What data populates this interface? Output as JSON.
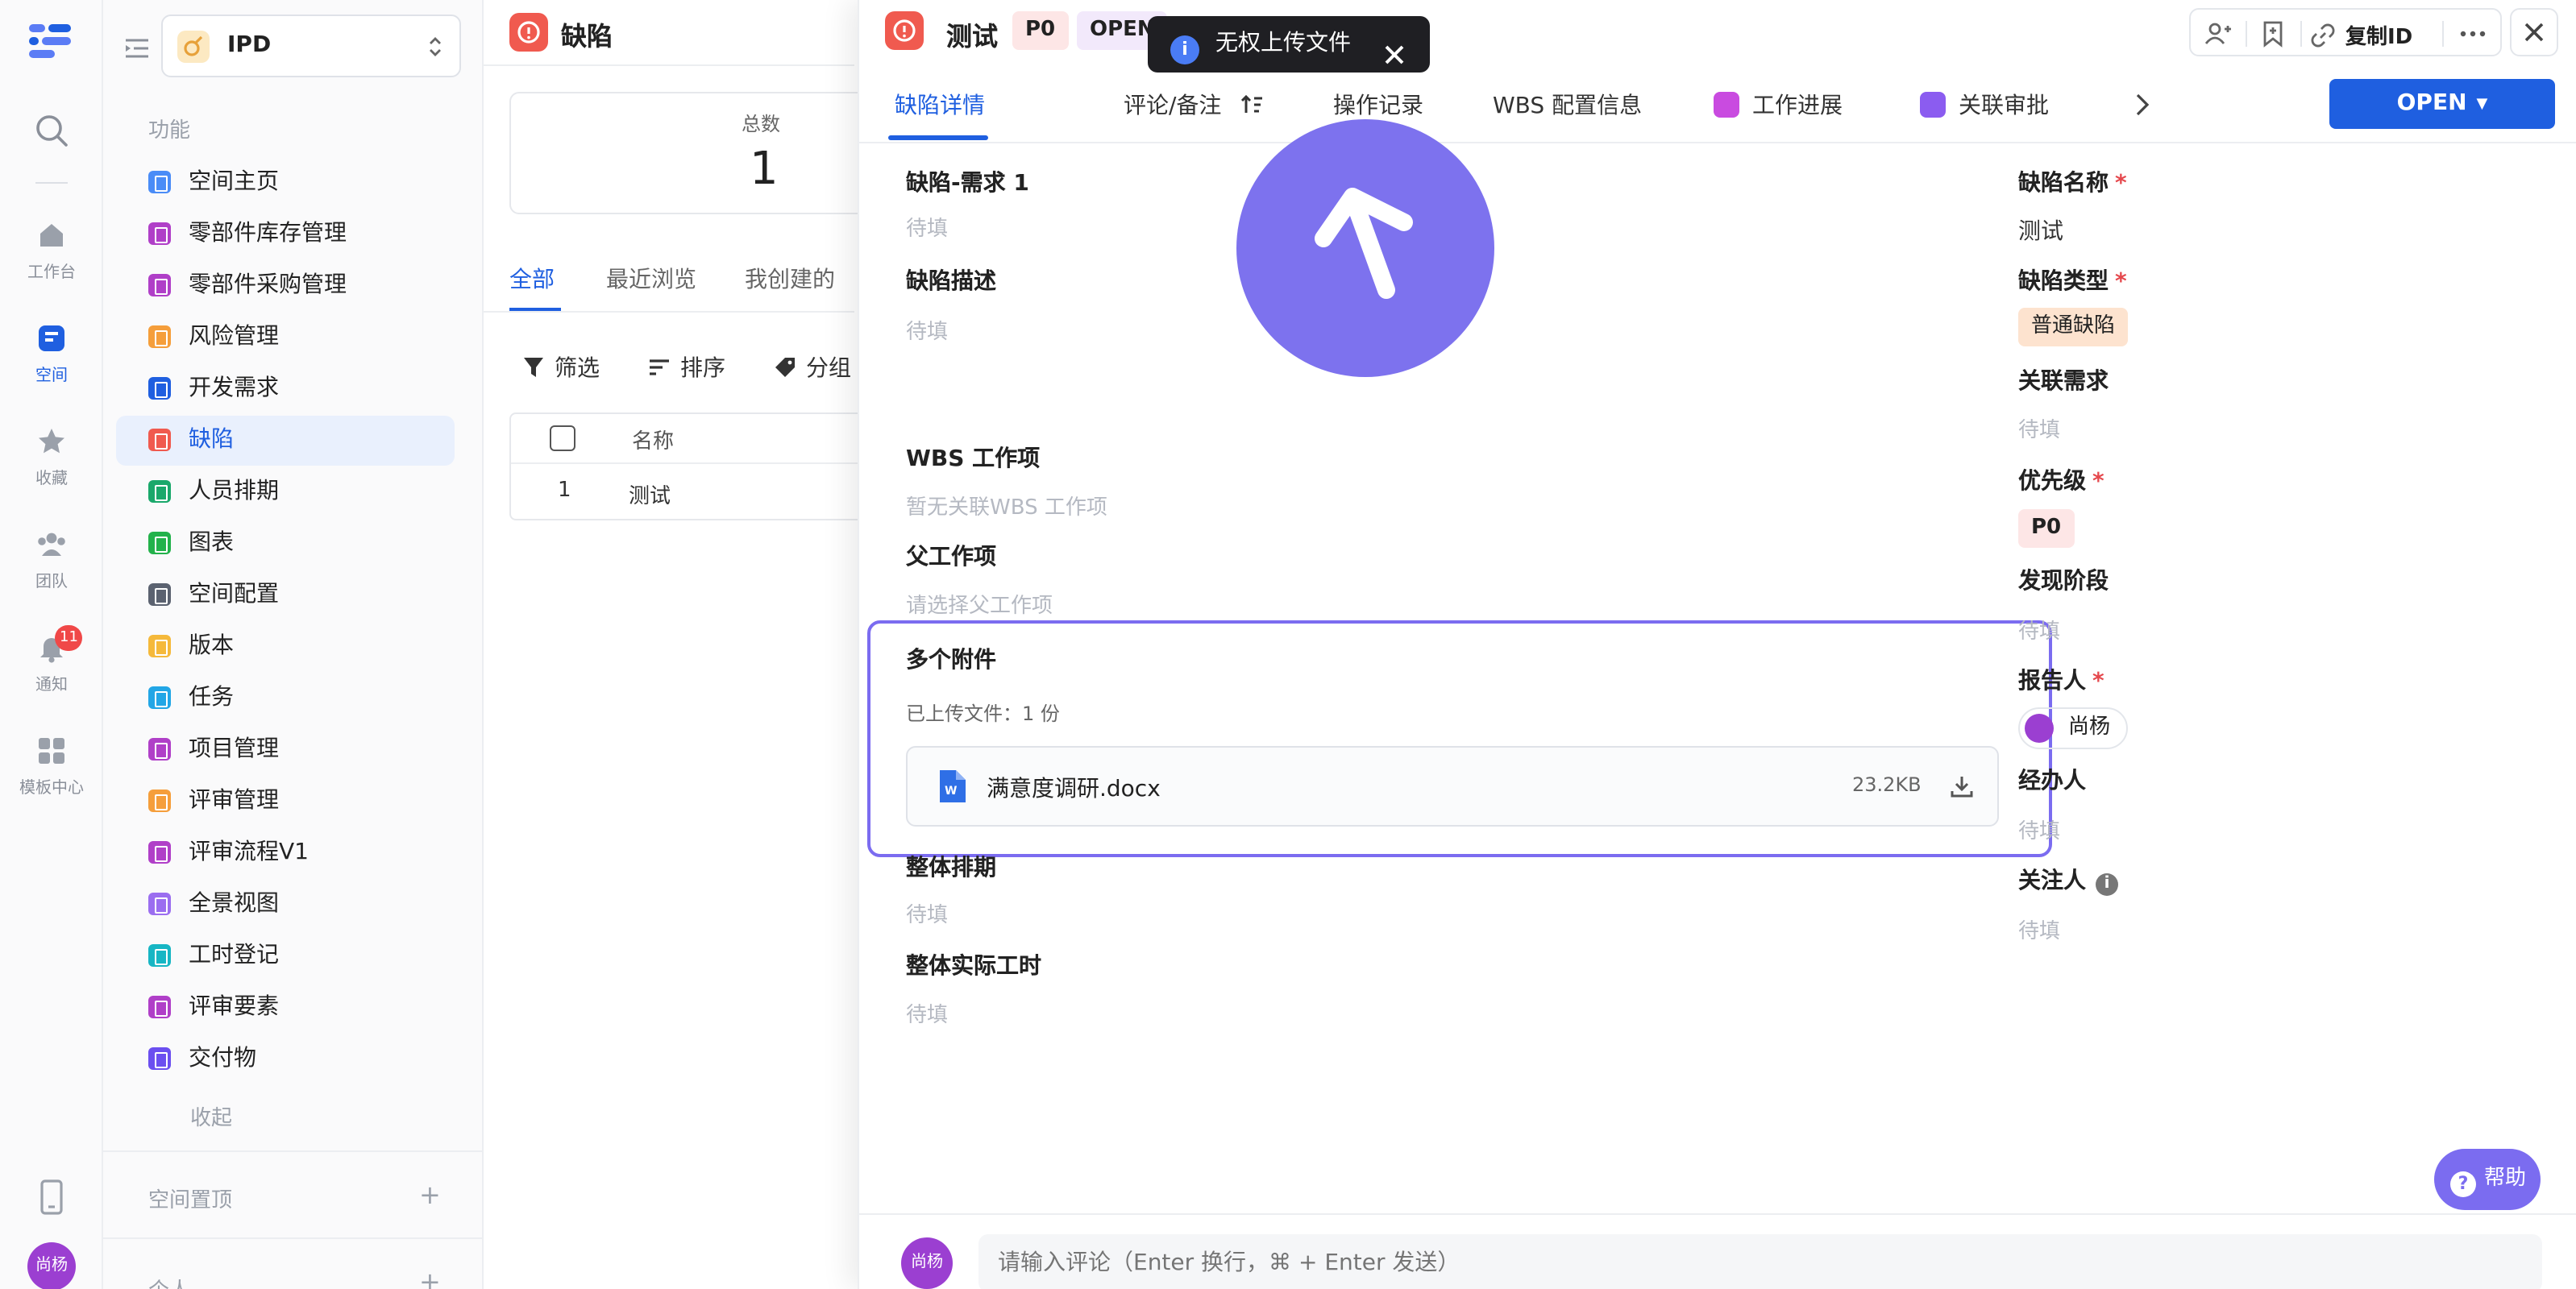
{
  "rail": {
    "items": [
      {
        "label": "工作台"
      },
      {
        "label": "空间"
      },
      {
        "label": "收藏"
      },
      {
        "label": "团队"
      },
      {
        "label": "通知",
        "badge": "11"
      },
      {
        "label": "模板中心"
      }
    ],
    "avatar": "尚杨"
  },
  "sidebar": {
    "space_name": "IPD",
    "section_title": "功能",
    "items": [
      {
        "label": "空间主页",
        "color": "#4a8cf7"
      },
      {
        "label": "零部件库存管理",
        "color": "#b03fc8"
      },
      {
        "label": "零部件采购管理",
        "color": "#b03fc8"
      },
      {
        "label": "风险管理",
        "color": "#f59e3b"
      },
      {
        "label": "开发需求",
        "color": "#1f5fe0"
      },
      {
        "label": "缺陷",
        "color": "#f05a4f"
      },
      {
        "label": "人员排期",
        "color": "#1aa86b"
      },
      {
        "label": "图表",
        "color": "#23b24b"
      },
      {
        "label": "空间配置",
        "color": "#5b6270"
      },
      {
        "label": "版本",
        "color": "#f5b93b"
      },
      {
        "label": "任务",
        "color": "#22a6e6"
      },
      {
        "label": "项目管理",
        "color": "#b03fc8"
      },
      {
        "label": "评审管理",
        "color": "#f59e3b"
      },
      {
        "label": "评审流程V1",
        "color": "#b03fc8"
      },
      {
        "label": "全景视图",
        "color": "#9b6ef0"
      },
      {
        "label": "工时登记",
        "color": "#17b6c4"
      },
      {
        "label": "评审要素",
        "color": "#b03fc8"
      },
      {
        "label": "交付物",
        "color": "#6b4ff0"
      }
    ],
    "collapse": "收起",
    "pinned": "空间置顶",
    "personal": "个人"
  },
  "middle": {
    "title": "缺陷",
    "total_label": "总数",
    "total_value": "1",
    "tabs": [
      "全部",
      "最近浏览",
      "我创建的"
    ],
    "toolbar": {
      "filter": "筛选",
      "sort": "排序",
      "group": "分组"
    },
    "table": {
      "header_name": "名称",
      "rows": [
        {
          "index": "1",
          "name": "测试"
        }
      ]
    }
  },
  "toast": {
    "text": "无权上传文件"
  },
  "drawer": {
    "title": "测试",
    "priority_tag": "P0",
    "status_tag": "OPEN",
    "copy_id": "复制ID",
    "tabs": [
      "缺陷详情",
      "评论/备注",
      "操作记录",
      "WBS 配置信息",
      "工作进展",
      "关联审批"
    ],
    "status_button": "OPEN",
    "left": {
      "req_label": "缺陷-需求 1",
      "req_value": "待填",
      "desc_label": "缺陷描述",
      "desc_value": "待填",
      "wbs_label": "WBS 工作项",
      "wbs_value": "暂无关联WBS 工作项",
      "parent_label": "父工作项",
      "parent_value": "请选择父工作项",
      "attach_label": "多个附件",
      "attach_count": "已上传文件：1 份",
      "file_name": "满意度调研.docx",
      "file_size": "23.2KB",
      "schedule_label": "整体排期",
      "schedule_value": "待填",
      "hours_label": "整体实际工时",
      "hours_value": "待填"
    },
    "right": {
      "name_label": "缺陷名称",
      "name_value": "测试",
      "type_label": "缺陷类型",
      "type_value": "普通缺陷",
      "linked_label": "关联需求",
      "linked_value": "待填",
      "priority_label": "优先级",
      "priority_value": "P0",
      "stage_label": "发现阶段",
      "stage_value": "待填",
      "reporter_label": "报告人",
      "reporter_value": "尚杨",
      "handler_label": "经办人",
      "handler_value": "待填",
      "follower_label": "关注人",
      "follower_value": "待填"
    },
    "comment_placeholder": "请输入评论（Enter 换行，⌘ + Enter 发送）",
    "comment_avatar": "尚杨",
    "help": "帮助"
  }
}
